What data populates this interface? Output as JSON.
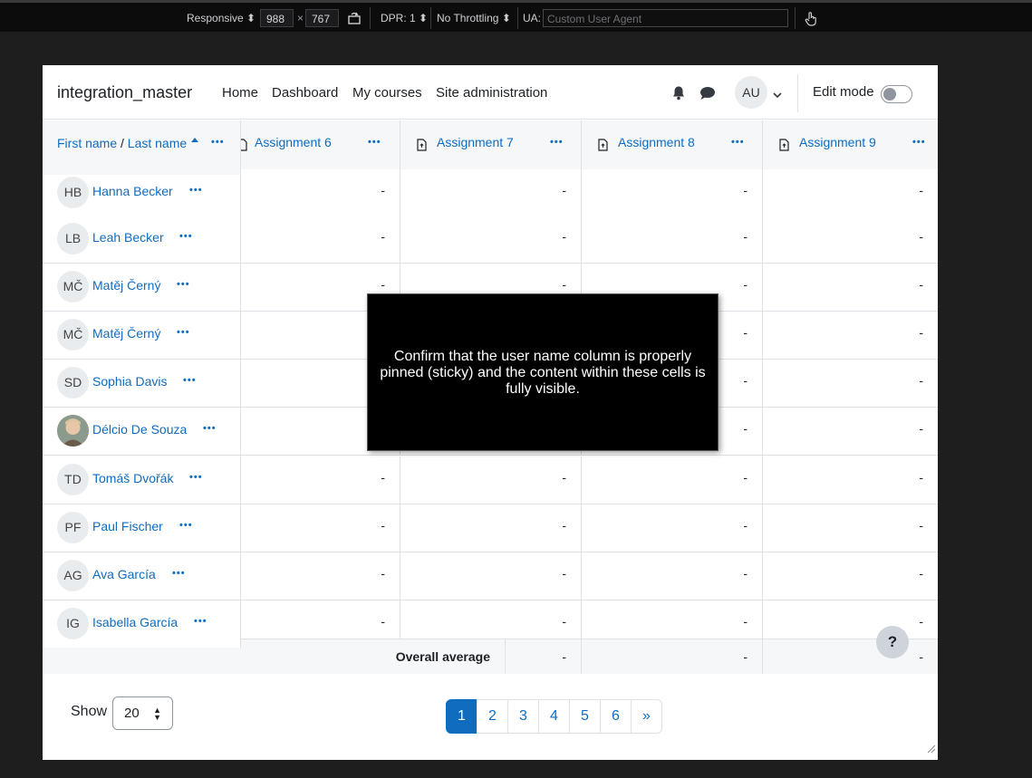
{
  "devtools": {
    "responsive": "Responsive",
    "width": "988",
    "height": "767",
    "times": "×",
    "dpr": "DPR: 1",
    "throttling": "No Throttling",
    "ua_label": "UA:",
    "ua_placeholder": "Custom User Agent"
  },
  "navbar": {
    "brand": "integration_master",
    "links": [
      "Home",
      "Dashboard",
      "My courses",
      "Site administration"
    ],
    "avatar": "AU",
    "edit_mode": "Edit mode",
    "edit_mode_on": false
  },
  "grid": {
    "first_name": "First name",
    "separator": " / ",
    "last_name": "Last name",
    "assignments": [
      "Assignment 6",
      "Assignment 7",
      "Assignment 8",
      "Assignment 9"
    ],
    "dash": "-",
    "users": [
      {
        "initials": "HB",
        "name": "Hanna Becker"
      },
      {
        "initials": "LB",
        "name": "Leah Becker"
      },
      {
        "initials": "MČ",
        "name": "Matěj Černý"
      },
      {
        "initials": "MČ",
        "name": "Matěj Černý"
      },
      {
        "initials": "SD",
        "name": "Sophia Davis"
      },
      {
        "initials": "",
        "name": "Délcio De Souza",
        "photo": true
      },
      {
        "initials": "TD",
        "name": "Tomáš Dvořák"
      },
      {
        "initials": "PF",
        "name": "Paul Fischer"
      },
      {
        "initials": "AG",
        "name": "Ava García"
      },
      {
        "initials": "IG",
        "name": "Isabella García"
      }
    ],
    "overall_average": "Overall average"
  },
  "footer": {
    "show": "Show",
    "per_page": "20",
    "pages": [
      "1",
      "2",
      "3",
      "4",
      "5",
      "6",
      "»"
    ],
    "current_page": "1"
  },
  "help": "?",
  "overlay": {
    "message": "Confirm that the user name column is properly pinned (sticky) and the content within these cells is fully visible."
  },
  "colors": {
    "link": "#0f6cbf",
    "header_bg": "#f5f7f9"
  }
}
